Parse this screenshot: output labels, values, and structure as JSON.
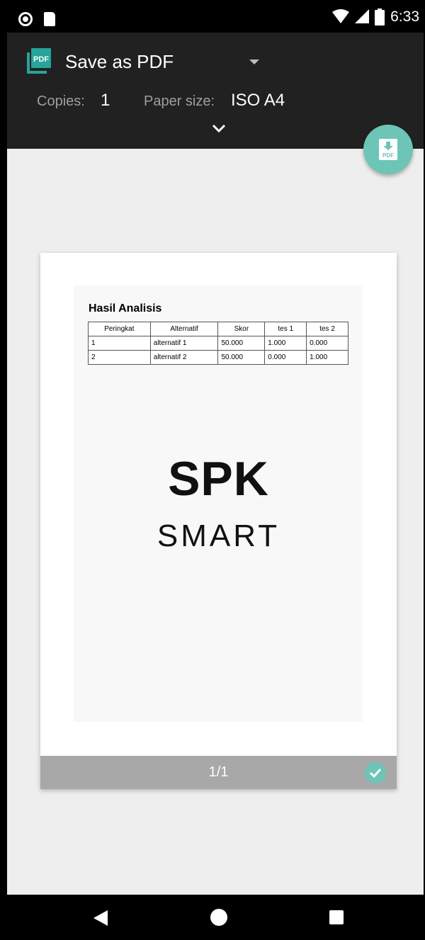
{
  "status_bar": {
    "time": "6:33",
    "icons": [
      "record-icon",
      "sd-card-icon",
      "wifi-icon",
      "signal-icon",
      "battery-icon"
    ]
  },
  "header": {
    "destination": "Save as PDF",
    "copies_label": "Copies:",
    "copies_value": "1",
    "paper_size_label": "Paper size:",
    "paper_size_value": "ISO A4",
    "icons": [
      "pdf-app-icon",
      "dropdown-arrow-icon",
      "expand-chevron-icon"
    ]
  },
  "fab": {
    "icon": "download-pdf-icon",
    "icon_text": "PDF"
  },
  "preview": {
    "page_number": "1/1",
    "document": {
      "title": "Hasil Analisis",
      "table": {
        "headers": [
          "Peringkat",
          "Alternatif",
          "Skor",
          "tes 1",
          "tes 2"
        ],
        "rows": [
          [
            "1",
            "alternatif 1",
            "50.000",
            "1.000",
            "0.000"
          ],
          [
            "2",
            "alternatif 2",
            "50.000",
            "0.000",
            "1.000"
          ]
        ]
      },
      "logo_line1": "SPK",
      "logo_line2": "SMART"
    }
  },
  "colors": {
    "header_bg": "#212121",
    "accent": "#6cc5b6",
    "preview_bg": "#eeeeee",
    "page_footer": "#a8a8a8"
  },
  "nav_bar": {
    "icons": [
      "back-icon",
      "home-icon",
      "recents-icon"
    ]
  }
}
